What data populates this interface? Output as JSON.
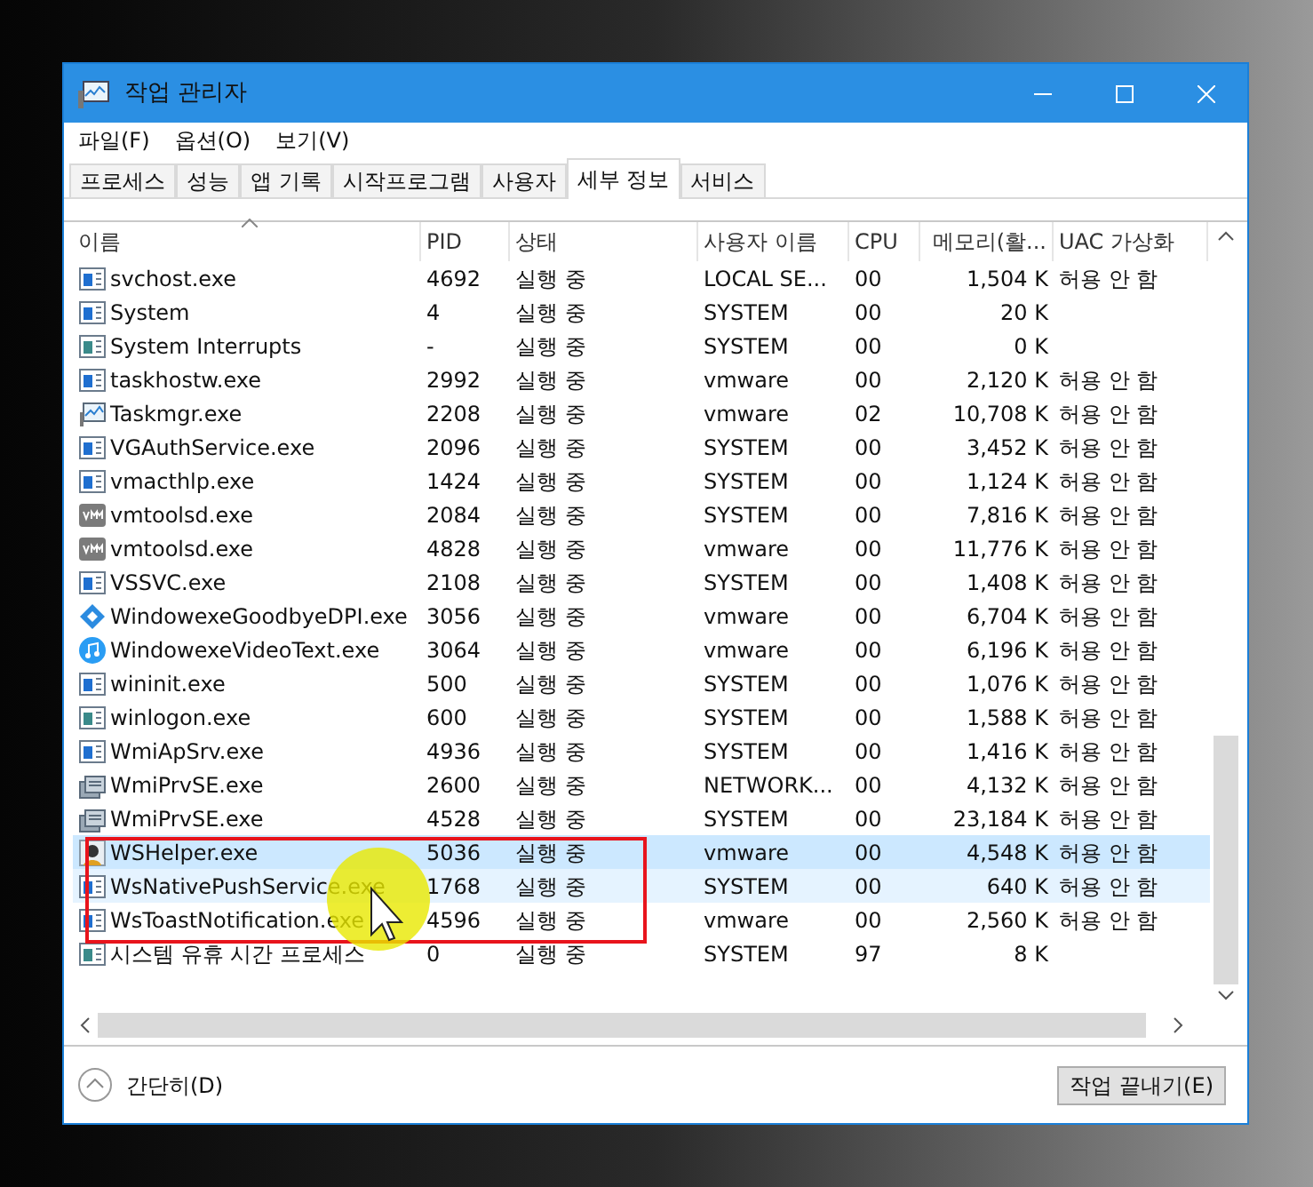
{
  "window": {
    "title": "작업 관리자"
  },
  "menu": [
    "파일(F)",
    "옵션(O)",
    "보기(V)"
  ],
  "tabs": [
    {
      "label": "프로세스",
      "selected": false
    },
    {
      "label": "성능",
      "selected": false
    },
    {
      "label": "앱 기록",
      "selected": false
    },
    {
      "label": "시작프로그램",
      "selected": false
    },
    {
      "label": "사용자",
      "selected": false
    },
    {
      "label": "세부 정보",
      "selected": true
    },
    {
      "label": "서비스",
      "selected": false
    }
  ],
  "table": {
    "columns": [
      "이름",
      "PID",
      "상태",
      "사용자 이름",
      "CPU",
      "메모리(활...",
      "UAC 가상화"
    ],
    "rows": [
      {
        "kind": "window",
        "cells": [
          "svchost.exe",
          "4692",
          "실행 중",
          "LOCAL SE...",
          "00",
          "1,504 K",
          "허용 안 함"
        ],
        "selected": false,
        "hovered": false,
        "highlighted": false
      },
      {
        "kind": "window",
        "cells": [
          "System",
          "4",
          "실행 중",
          "SYSTEM",
          "00",
          "20 K",
          ""
        ],
        "selected": false,
        "hovered": false,
        "highlighted": false
      },
      {
        "kind": "system",
        "cells": [
          "System Interrupts",
          "-",
          "실행 중",
          "SYSTEM",
          "00",
          "0 K",
          ""
        ],
        "selected": false,
        "hovered": false,
        "highlighted": false
      },
      {
        "kind": "window",
        "cells": [
          "taskhostw.exe",
          "2992",
          "실행 중",
          "vmware",
          "00",
          "2,120 K",
          "허용 안 함"
        ],
        "selected": false,
        "hovered": false,
        "highlighted": false
      },
      {
        "kind": "monitor",
        "cells": [
          "Taskmgr.exe",
          "2208",
          "실행 중",
          "vmware",
          "02",
          "10,708 K",
          "허용 안 함"
        ],
        "selected": false,
        "hovered": false,
        "highlighted": false
      },
      {
        "kind": "window",
        "cells": [
          "VGAuthService.exe",
          "2096",
          "실행 중",
          "SYSTEM",
          "00",
          "3,452 K",
          "허용 안 함"
        ],
        "selected": false,
        "hovered": false,
        "highlighted": false
      },
      {
        "kind": "window",
        "cells": [
          "vmacthlp.exe",
          "1424",
          "실행 중",
          "SYSTEM",
          "00",
          "1,124 K",
          "허용 안 함"
        ],
        "selected": false,
        "hovered": false,
        "highlighted": false
      },
      {
        "kind": "vm",
        "cells": [
          "vmtoolsd.exe",
          "2084",
          "실행 중",
          "SYSTEM",
          "00",
          "7,816 K",
          "허용 안 함"
        ],
        "selected": false,
        "hovered": false,
        "highlighted": false
      },
      {
        "kind": "vm",
        "cells": [
          "vmtoolsd.exe",
          "4828",
          "실행 중",
          "vmware",
          "00",
          "11,776 K",
          "허용 안 함"
        ],
        "selected": false,
        "hovered": false,
        "highlighted": false
      },
      {
        "kind": "window",
        "cells": [
          "VSSVC.exe",
          "2108",
          "실행 중",
          "SYSTEM",
          "00",
          "1,408 K",
          "허용 안 함"
        ],
        "selected": false,
        "hovered": false,
        "highlighted": false
      },
      {
        "kind": "diamond",
        "cells": [
          "WindowexeGoodbyeDPI.exe",
          "3056",
          "실행 중",
          "vmware",
          "00",
          "6,704 K",
          "허용 안 함"
        ],
        "selected": false,
        "hovered": false,
        "highlighted": false
      },
      {
        "kind": "music",
        "cells": [
          "WindowexeVideoText.exe",
          "3064",
          "실행 중",
          "vmware",
          "00",
          "6,196 K",
          "허용 안 함"
        ],
        "selected": false,
        "hovered": false,
        "highlighted": false
      },
      {
        "kind": "window",
        "cells": [
          "wininit.exe",
          "500",
          "실행 중",
          "SYSTEM",
          "00",
          "1,076 K",
          "허용 안 함"
        ],
        "selected": false,
        "hovered": false,
        "highlighted": false
      },
      {
        "kind": "system",
        "cells": [
          "winlogon.exe",
          "600",
          "실행 중",
          "SYSTEM",
          "00",
          "1,588 K",
          "허용 안 함"
        ],
        "selected": false,
        "hovered": false,
        "highlighted": false
      },
      {
        "kind": "window",
        "cells": [
          "WmiApSrv.exe",
          "4936",
          "실행 중",
          "SYSTEM",
          "00",
          "1,416 K",
          "허용 안 함"
        ],
        "selected": false,
        "hovered": false,
        "highlighted": false
      },
      {
        "kind": "wmi",
        "cells": [
          "WmiPrvSE.exe",
          "2600",
          "실행 중",
          "NETWORK...",
          "00",
          "4,132 K",
          "허용 안 함"
        ],
        "selected": false,
        "hovered": false,
        "highlighted": false
      },
      {
        "kind": "wmi",
        "cells": [
          "WmiPrvSE.exe",
          "4528",
          "실행 중",
          "SYSTEM",
          "00",
          "23,184 K",
          "허용 안 함"
        ],
        "selected": false,
        "hovered": false,
        "highlighted": false
      },
      {
        "kind": "helper",
        "cells": [
          "WSHelper.exe",
          "5036",
          "실행 중",
          "vmware",
          "00",
          "4,548 K",
          "허용 안 함"
        ],
        "selected": true,
        "hovered": false,
        "highlighted": true
      },
      {
        "kind": "window",
        "cells": [
          "WsNativePushService.exe",
          "1768",
          "실행 중",
          "SYSTEM",
          "00",
          "640 K",
          "허용 안 함"
        ],
        "selected": false,
        "hovered": true,
        "highlighted": true
      },
      {
        "kind": "window",
        "cells": [
          "WsToastNotification.exe",
          "4596",
          "실행 중",
          "vmware",
          "00",
          "2,560 K",
          "허용 안 함"
        ],
        "selected": false,
        "hovered": false,
        "highlighted": true
      },
      {
        "kind": "system",
        "cells": [
          "시스템 유휴 시간 프로세스",
          "0",
          "실행 중",
          "SYSTEM",
          "97",
          "8 K",
          ""
        ],
        "selected": false,
        "hovered": false,
        "highlighted": false
      }
    ]
  },
  "footer": {
    "collapse": "간단히(D)",
    "end_task": "작업 끝내기(E)"
  }
}
